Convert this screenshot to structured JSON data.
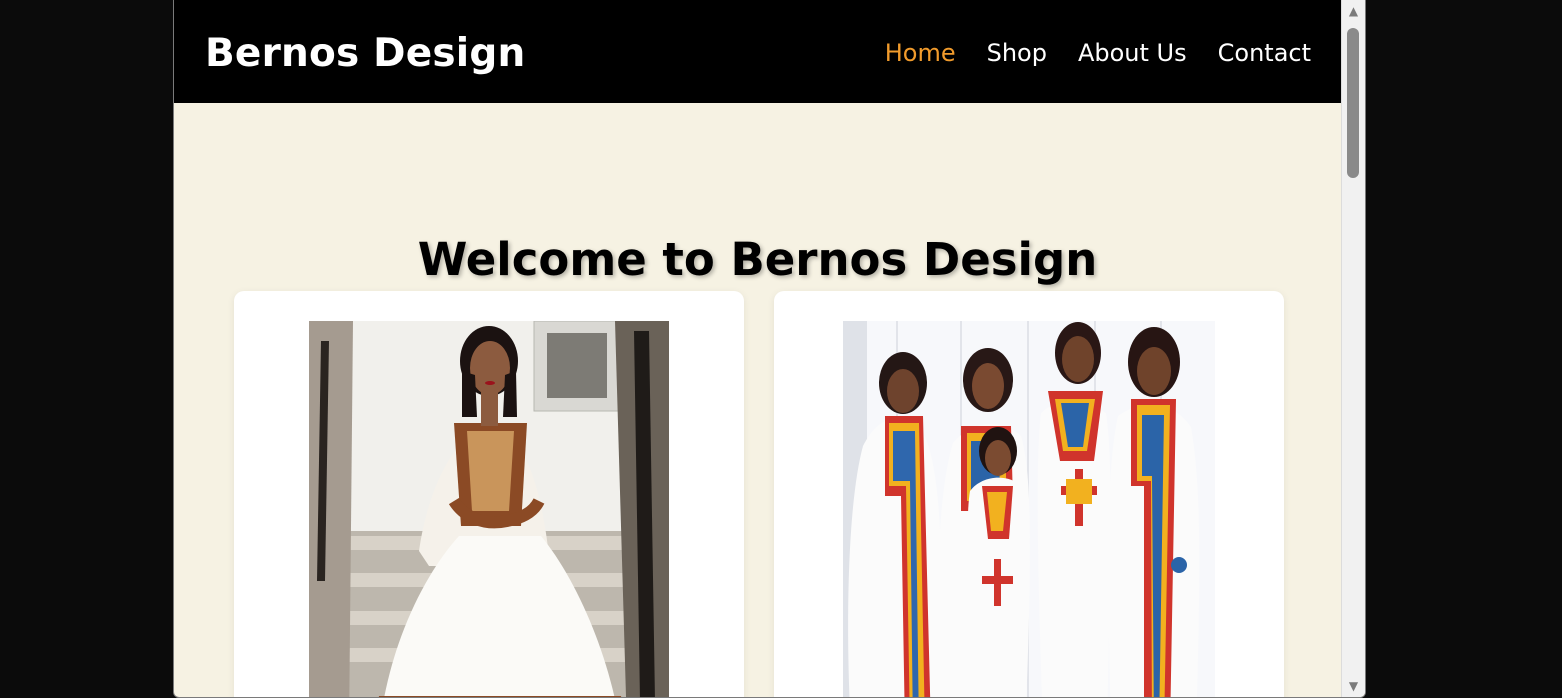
{
  "brand": "Bernos Design",
  "nav": {
    "items": [
      {
        "label": "Home",
        "active": true
      },
      {
        "label": "Shop",
        "active": false
      },
      {
        "label": "About Us",
        "active": false
      },
      {
        "label": "Contact",
        "active": false
      }
    ]
  },
  "hero": {
    "title": "Welcome to Bernos Design"
  },
  "colors": {
    "navbar_bg": "#000000",
    "active_link": "#f19b2c",
    "page_bg": "#f6f2e3",
    "card_bg": "#ffffff"
  },
  "icons": {
    "scroll_up": "triangle-up-icon",
    "scroll_down": "triangle-down-icon"
  }
}
